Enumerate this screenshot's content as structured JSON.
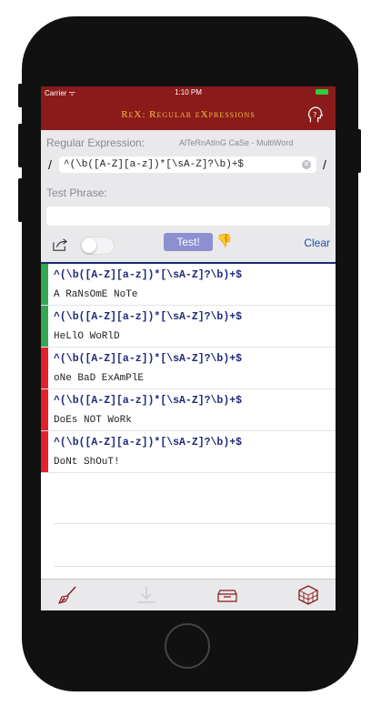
{
  "status": {
    "carrier": "Carrier ᯤ",
    "time": "1:10 PM"
  },
  "navbar": {
    "title": "ReX: Regular eXpressions",
    "help_icon": "head-question-icon"
  },
  "panel": {
    "regex_label": "Regular Expression:",
    "mode": "AlTeRnAtInG CaSe - MultiWord",
    "slash": "/",
    "regex_value": "^(\\b([A-Z][a-z])*[\\sA-Z]?\\b)+$",
    "clear_glyph": "✕",
    "phrase_label": "Test Phrase:",
    "phrase_value": "",
    "test_label": "Test!",
    "thumb_glyph": "👎",
    "clear_label": "Clear"
  },
  "results": [
    {
      "pattern": "^(\\b([A-Z][a-z])*[\\sA-Z]?\\b)+$",
      "phrase": "A RaNsOmE NoTe",
      "status": "match"
    },
    {
      "pattern": "^(\\b([A-Z][a-z])*[\\sA-Z]?\\b)+$",
      "phrase": "HeLlO WoRlD",
      "status": "match"
    },
    {
      "pattern": "^(\\b([A-Z][a-z])*[\\sA-Z]?\\b)+$",
      "phrase": "oNe BaD ExAmPlE",
      "status": "fail"
    },
    {
      "pattern": "^(\\b([A-Z][a-z])*[\\sA-Z]?\\b)+$",
      "phrase": "DoEs NOT WoRk",
      "status": "fail"
    },
    {
      "pattern": "^(\\b([A-Z][a-z])*[\\sA-Z]?\\b)+$",
      "phrase": "DoNt ShOuT!",
      "status": "fail"
    }
  ],
  "colors": {
    "match": "#34a853",
    "fail": "#e8202a",
    "brand": "#8b1a1a",
    "accent": "#f0c040"
  },
  "toolbar": [
    "broom-icon",
    "download-icon",
    "archive-box-icon",
    "cube-icon"
  ]
}
